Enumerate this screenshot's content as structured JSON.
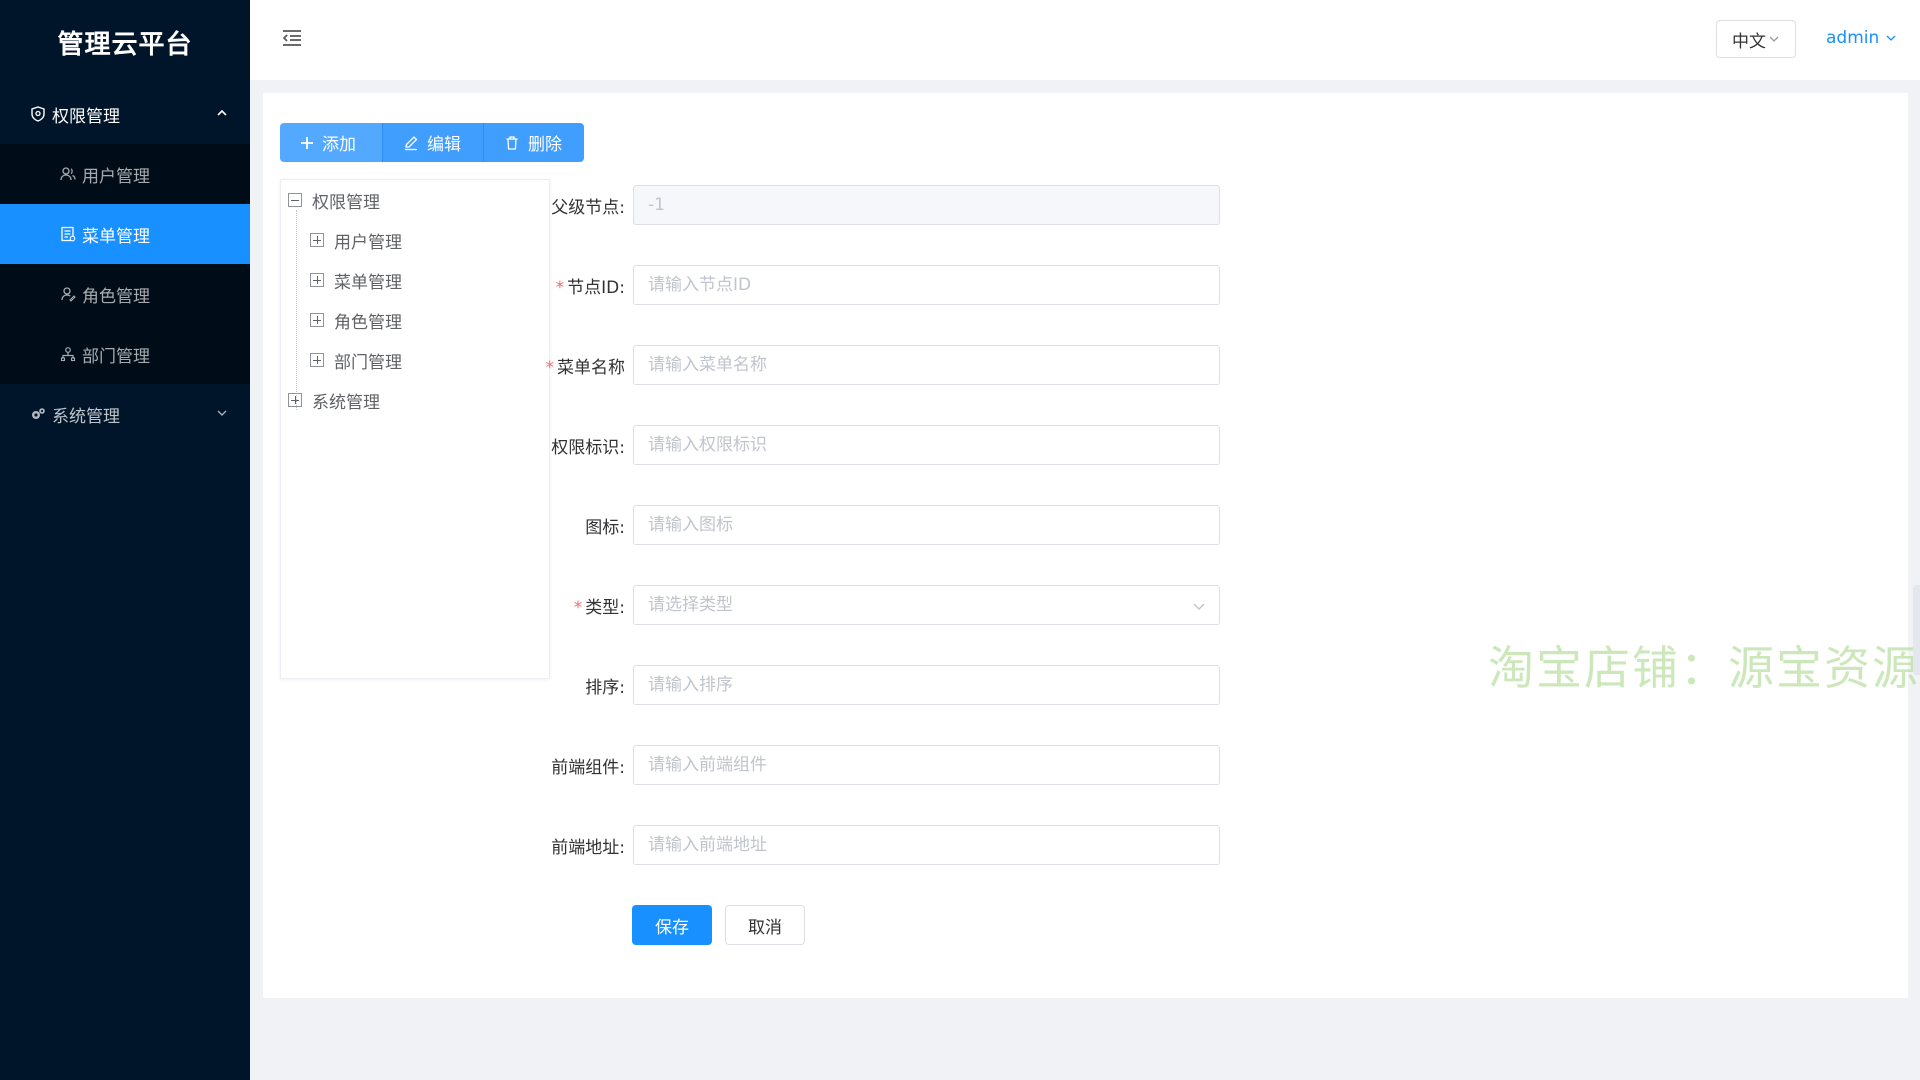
{
  "app": {
    "title": "管理云平台"
  },
  "sidebar": {
    "groups": [
      {
        "label": "权限管理",
        "expanded": true,
        "items": [
          {
            "label": "用户管理",
            "icon": "user-icon"
          },
          {
            "label": "菜单管理",
            "icon": "menu-doc-icon",
            "active": true
          },
          {
            "label": "角色管理",
            "icon": "role-icon"
          },
          {
            "label": "部门管理",
            "icon": "org-icon"
          }
        ]
      },
      {
        "label": "系统管理",
        "expanded": false,
        "items": []
      }
    ]
  },
  "header": {
    "language": "中文",
    "user": "admin"
  },
  "toolbar": {
    "add_label": "添加",
    "edit_label": "编辑",
    "delete_label": "删除"
  },
  "tree": {
    "nodes": [
      {
        "label": "权限管理",
        "expanded": true,
        "children": [
          "用户管理",
          "菜单管理",
          "角色管理",
          "部门管理"
        ]
      },
      {
        "label": "系统管理",
        "expanded": false,
        "children": []
      }
    ]
  },
  "form": {
    "parent": {
      "label": "父级节点:",
      "value": "-1",
      "required": false
    },
    "node_id": {
      "label": "节点ID:",
      "placeholder": "请输入节点ID",
      "required": true
    },
    "menu_name": {
      "label": "菜单名称",
      "placeholder": "请输入菜单名称",
      "required": true
    },
    "permission": {
      "label": "权限标识:",
      "placeholder": "请输入权限标识",
      "required": false
    },
    "icon": {
      "label": "图标:",
      "placeholder": "请输入图标",
      "required": false
    },
    "type": {
      "label": "类型:",
      "placeholder": "请选择类型",
      "required": true
    },
    "sort": {
      "label": "排序:",
      "placeholder": "请输入排序",
      "required": false
    },
    "component": {
      "label": "前端组件:",
      "placeholder": "请输入前端组件",
      "required": false
    },
    "path": {
      "label": "前端地址:",
      "placeholder": "请输入前端地址",
      "required": false
    },
    "save_label": "保存",
    "cancel_label": "取消",
    "required_mark": "*"
  },
  "watermark": "淘宝店铺：源宝资源",
  "colors": {
    "sidebar_bg": "#001529",
    "submenu_bg": "#000c17",
    "accent": "#1890ff",
    "toolbar_btn": "#409eff",
    "required": "#f56c6c"
  }
}
